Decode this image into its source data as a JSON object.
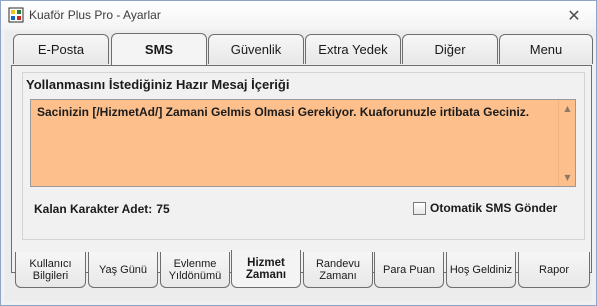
{
  "window": {
    "title": "Kuaför Plus Pro - Ayarlar",
    "close_glyph": "✕"
  },
  "top_tabs": [
    {
      "label": "E-Posta",
      "active": false
    },
    {
      "label": "SMS",
      "active": true
    },
    {
      "label": "Güvenlik",
      "active": false
    },
    {
      "label": "Extra Yedek",
      "active": false
    },
    {
      "label": "Diğer",
      "active": false
    },
    {
      "label": "Menu",
      "active": false
    }
  ],
  "sms_panel": {
    "group_title": "Yollanmasını İstediğiniz Hazır Mesaj İçeriği",
    "message_text": "Sacinizin [/HizmetAd/] Zamani Gelmis Olmasi Gerekiyor. Kuaforunuzle irtibata Geciniz.",
    "message_bg_color": "#fdc08d",
    "remaining_label": "Kalan Karakter Adet:",
    "remaining_value": "75",
    "auto_sms_label": "Otomatik SMS Gönder",
    "auto_sms_checked": false
  },
  "bottom_tabs": [
    {
      "label": "Kullanıcı Bilgileri",
      "active": false
    },
    {
      "label": "Yaş Günü",
      "active": false
    },
    {
      "label": "Evlenme Yıldönümü",
      "active": false
    },
    {
      "label": "Hizmet Zamanı",
      "active": true
    },
    {
      "label": "Randevu Zamanı",
      "active": false
    },
    {
      "label": "Para Puan",
      "active": false
    },
    {
      "label": "Hoş Geldiniz",
      "active": false
    },
    {
      "label": "Rapor",
      "active": false
    }
  ]
}
